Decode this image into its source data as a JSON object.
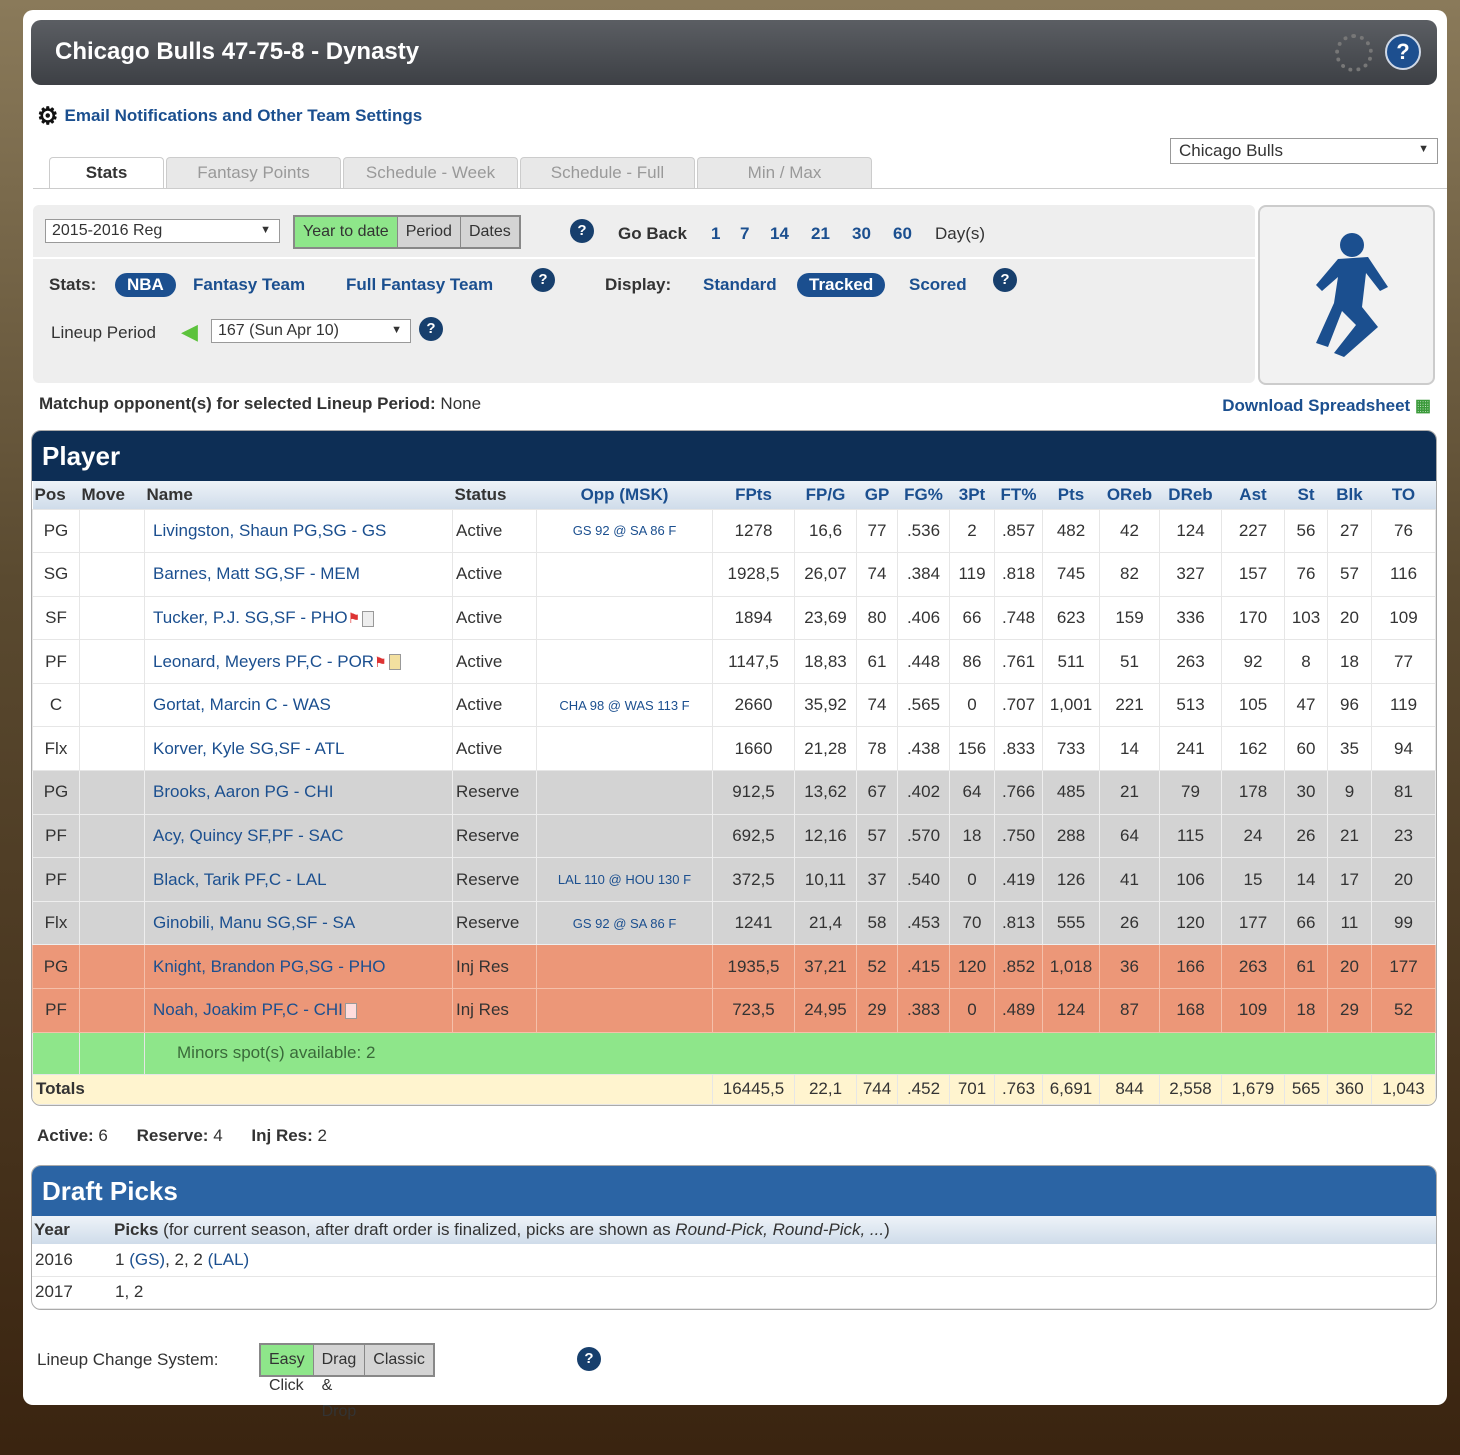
{
  "header": {
    "title": "Chicago Bulls 47-75-8 - Dynasty",
    "help": "?"
  },
  "settings_link": "Email Notifications and Other Team Settings",
  "tabs": [
    "Stats",
    "Fantasy Points",
    "Schedule - Week",
    "Schedule - Full",
    "Min / Max"
  ],
  "team_select": "Chicago Bulls",
  "filters": {
    "season": "2015-2016 Reg",
    "range": [
      "Year to date",
      "Period",
      "Dates"
    ],
    "go_back_label": "Go Back",
    "go_back": [
      "1",
      "7",
      "14",
      "21",
      "30",
      "60"
    ],
    "days_label": "Day(s)",
    "stats_label": "Stats:",
    "stats": [
      "NBA",
      "Fantasy Team",
      "Full Fantasy Team"
    ],
    "display_label": "Display:",
    "display": [
      "Standard",
      "Tracked",
      "Scored"
    ],
    "lineup_label": "Lineup Period",
    "lineup_value": "167 (Sun Apr 10)"
  },
  "matchup": {
    "label": "Matchup opponent(s) for selected Lineup Period:",
    "value": "None"
  },
  "download": "Download Spreadsheet",
  "player_table": {
    "title": "Player",
    "columns": [
      "Pos",
      "Move",
      "Name",
      "Status",
      "Opp (MSK)",
      "FPts",
      "FP/G",
      "GP",
      "FG%",
      "3Pt",
      "FT%",
      "Pts",
      "OReb",
      "DReb",
      "Ast",
      "St",
      "Blk",
      "TO"
    ],
    "rows": [
      {
        "type": "active",
        "pos": "PG",
        "name": "Livingston, Shaun PG,SG - GS",
        "icons": [],
        "status": "Active",
        "opp": "GS 92 @ SA 86 F",
        "stats": [
          "1278",
          "16,6",
          "77",
          ".536",
          "2",
          ".857",
          "482",
          "42",
          "124",
          "227",
          "56",
          "27",
          "76"
        ]
      },
      {
        "type": "active",
        "pos": "SG",
        "name": "Barnes, Matt SG,SF - MEM",
        "icons": [],
        "status": "Active",
        "opp": "",
        "stats": [
          "1928,5",
          "26,07",
          "74",
          ".384",
          "119",
          ".818",
          "745",
          "82",
          "327",
          "157",
          "76",
          "57",
          "116"
        ]
      },
      {
        "type": "active",
        "pos": "SF",
        "name": "Tucker, P.J. SG,SF - PHO",
        "icons": [
          "flag",
          "note"
        ],
        "status": "Active",
        "opp": "",
        "stats": [
          "1894",
          "23,69",
          "80",
          ".406",
          "66",
          ".748",
          "623",
          "159",
          "336",
          "170",
          "103",
          "20",
          "109"
        ]
      },
      {
        "type": "active",
        "pos": "PF",
        "name": "Leonard, Meyers PF,C - POR",
        "icons": [
          "flag",
          "note-yellow"
        ],
        "status": "Active",
        "opp": "",
        "stats": [
          "1147,5",
          "18,83",
          "61",
          ".448",
          "86",
          ".761",
          "511",
          "51",
          "263",
          "92",
          "8",
          "18",
          "77"
        ]
      },
      {
        "type": "active",
        "pos": "C",
        "name": "Gortat, Marcin C - WAS",
        "icons": [],
        "status": "Active",
        "opp": "CHA 98 @ WAS 113 F",
        "stats": [
          "2660",
          "35,92",
          "74",
          ".565",
          "0",
          ".707",
          "1,001",
          "221",
          "513",
          "105",
          "47",
          "96",
          "119"
        ]
      },
      {
        "type": "active",
        "pos": "Flx",
        "name": "Korver, Kyle SG,SF - ATL",
        "icons": [],
        "status": "Active",
        "opp": "",
        "stats": [
          "1660",
          "21,28",
          "78",
          ".438",
          "156",
          ".833",
          "733",
          "14",
          "241",
          "162",
          "60",
          "35",
          "94"
        ]
      },
      {
        "type": "reserve",
        "pos": "PG",
        "name": "Brooks, Aaron PG - CHI",
        "icons": [],
        "status": "Reserve",
        "opp": "",
        "stats": [
          "912,5",
          "13,62",
          "67",
          ".402",
          "64",
          ".766",
          "485",
          "21",
          "79",
          "178",
          "30",
          "9",
          "81"
        ]
      },
      {
        "type": "reserve",
        "pos": "PF",
        "name": "Acy, Quincy SF,PF - SAC",
        "icons": [],
        "status": "Reserve",
        "opp": "",
        "stats": [
          "692,5",
          "12,16",
          "57",
          ".570",
          "18",
          ".750",
          "288",
          "64",
          "115",
          "24",
          "26",
          "21",
          "23"
        ]
      },
      {
        "type": "reserve",
        "pos": "PF",
        "name": "Black, Tarik PF,C - LAL",
        "icons": [],
        "status": "Reserve",
        "opp": "LAL 110 @ HOU 130 F",
        "stats": [
          "372,5",
          "10,11",
          "37",
          ".540",
          "0",
          ".419",
          "126",
          "41",
          "106",
          "15",
          "14",
          "17",
          "20"
        ]
      },
      {
        "type": "reserve",
        "pos": "Flx",
        "name": "Ginobili, Manu SG,SF - SA",
        "icons": [],
        "status": "Reserve",
        "opp": "GS 92 @ SA 86 F",
        "stats": [
          "1241",
          "21,4",
          "58",
          ".453",
          "70",
          ".813",
          "555",
          "26",
          "120",
          "177",
          "66",
          "11",
          "99"
        ]
      },
      {
        "type": "inj",
        "pos": "PG",
        "name": "Knight, Brandon PG,SG - PHO",
        "icons": [],
        "status": "Inj Res",
        "opp": "",
        "stats": [
          "1935,5",
          "37,21",
          "52",
          ".415",
          "120",
          ".852",
          "1,018",
          "36",
          "166",
          "263",
          "61",
          "20",
          "177"
        ]
      },
      {
        "type": "inj",
        "pos": "PF",
        "name": "Noah, Joakim PF,C - CHI",
        "icons": [
          "note-red"
        ],
        "status": "Inj Res",
        "opp": "",
        "stats": [
          "723,5",
          "24,95",
          "29",
          ".383",
          "0",
          ".489",
          "124",
          "87",
          "168",
          "109",
          "18",
          "29",
          "52"
        ]
      }
    ],
    "minors": "Minors spot(s) available: 2",
    "totals_label": "Totals",
    "totals": [
      "16445,5",
      "22,1",
      "744",
      ".452",
      "701",
      ".763",
      "6,691",
      "844",
      "2,558",
      "1,679",
      "565",
      "360",
      "1,043"
    ]
  },
  "counts": [
    {
      "label": "Active:",
      "value": "6"
    },
    {
      "label": "Reserve:",
      "value": "4"
    },
    {
      "label": "Inj Res:",
      "value": "2"
    }
  ],
  "draft_picks": {
    "title": "Draft Picks",
    "col_year": "Year",
    "col_picks": "Picks",
    "col_note": "(for current season, after draft order is finalized, picks are shown as ",
    "col_note_italic": "Round-Pick, Round-Pick, ...",
    "col_note_end": ")",
    "rows": [
      {
        "year": "2016",
        "picks": [
          "1 ",
          "(GS)",
          ", 2, 2 ",
          "(LAL)"
        ]
      },
      {
        "year": "2017",
        "picks": [
          "1, 2"
        ]
      }
    ]
  },
  "lineup_change": {
    "label": "Lineup Change System:",
    "options": [
      "Easy Click",
      "Drag & Drop",
      "Classic"
    ]
  }
}
